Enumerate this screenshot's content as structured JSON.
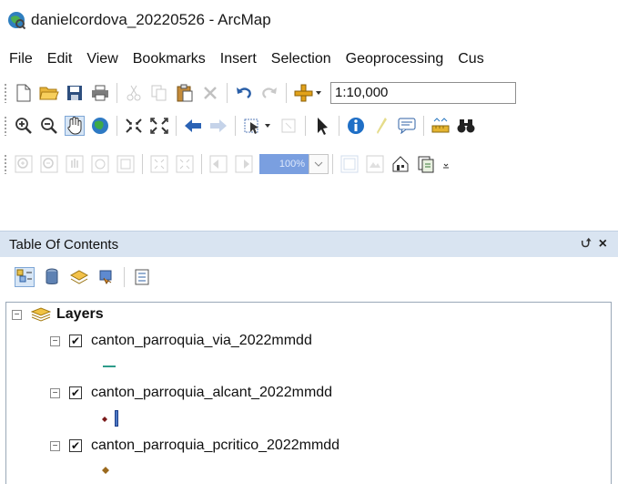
{
  "window": {
    "title": "danielcordova_20220526 - ArcMap",
    "app_icon": "arcmap-globe-icon"
  },
  "menubar": {
    "items": [
      "File",
      "Edit",
      "View",
      "Bookmarks",
      "Insert",
      "Selection",
      "Geoprocessing",
      "Cus"
    ]
  },
  "standard_toolbar": {
    "scale_value": "1:10,000"
  },
  "layout_toolbar": {
    "zoom_percent": "100%"
  },
  "toc": {
    "title": "Table Of Contents",
    "pin_glyph": "⮍",
    "close_glyph": "×",
    "root": {
      "label": "Layers",
      "expander": "−"
    },
    "layers": [
      {
        "name": "canton_parroquia_via_2022mmdd",
        "checked": true,
        "check_glyph": "✔",
        "expander": "−",
        "symbol": "line",
        "color": "#2e9c8a"
      },
      {
        "name": "canton_parroquia_alcant_2022mmdd",
        "checked": true,
        "check_glyph": "✔",
        "expander": "−",
        "symbol": "point-and-bar",
        "color": "#7a1a1a"
      },
      {
        "name": "canton_parroquia_pcritico_2022mmdd",
        "checked": true,
        "check_glyph": "✔",
        "expander": "−",
        "symbol": "point",
        "color": "#9b6a1e"
      }
    ]
  },
  "colors": {
    "toc_header_bg": "#d9e4f1",
    "selection_blue": "#7a9fe0"
  }
}
